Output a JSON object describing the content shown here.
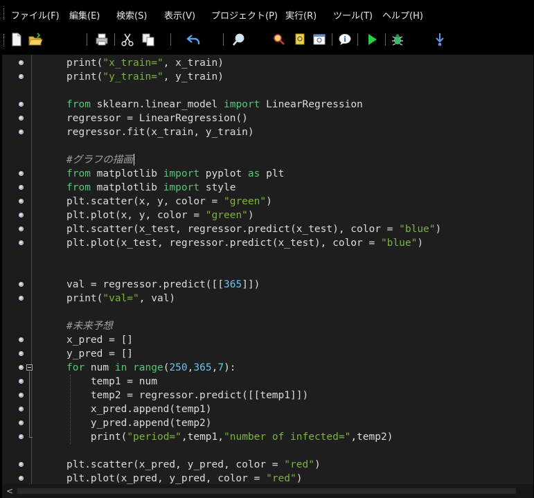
{
  "menu": [
    "ファイル(F)",
    "編集(E)",
    "検索(S)",
    "表示(V)",
    "プロジェクト(P)",
    "実行(R)",
    "ツール(T)",
    "ヘルプ(H)"
  ],
  "toolbar": {
    "icons": [
      "new-file-icon",
      "open-folder-icon",
      "print-icon",
      "cut-icon",
      "copy-icon",
      "undo-icon",
      "find-icon",
      "bookmark-icon",
      "note-icon",
      "window-icon",
      "info-icon",
      "run-icon",
      "debug-icon",
      "step-icon"
    ]
  },
  "editor": {
    "lines": [
      {
        "text": "print(\"x_train=\", x_train)",
        "bp": true
      },
      {
        "text": "print(\"y_train=\", y_train)",
        "bp": true
      },
      {
        "text": "",
        "bp": false
      },
      {
        "text": "from sklearn.linear_model import LinearRegression",
        "bp": true
      },
      {
        "text": "regressor = LinearRegression()",
        "bp": true
      },
      {
        "text": "regressor.fit(x_train, y_train)",
        "bp": true
      },
      {
        "text": "",
        "bp": false
      },
      {
        "text": "#グラフの描画",
        "bp": false
      },
      {
        "text": "from matplotlib import pyplot as plt",
        "bp": true
      },
      {
        "text": "from matplotlib import style",
        "bp": true
      },
      {
        "text": "plt.scatter(x, y, color = \"green\")",
        "bp": true
      },
      {
        "text": "plt.plot(x, y, color = \"green\")",
        "bp": true
      },
      {
        "text": "plt.scatter(x_test, regressor.predict(x_test), color = \"blue\")",
        "bp": true
      },
      {
        "text": "plt.plot(x_test, regressor.predict(x_test), color = \"blue\")",
        "bp": true
      },
      {
        "text": "",
        "bp": false
      },
      {
        "text": "",
        "bp": false
      },
      {
        "text": "val = regressor.predict([[365]])",
        "bp": true
      },
      {
        "text": "print(\"val=\", val)",
        "bp": true
      },
      {
        "text": "",
        "bp": false
      },
      {
        "text": "#未来予想",
        "bp": false
      },
      {
        "text": "x_pred = []",
        "bp": true
      },
      {
        "text": "y_pred = []",
        "bp": true
      },
      {
        "text": "for num in range(250,365,7):",
        "bp": true,
        "fold": true
      },
      {
        "text": "    temp1 = num",
        "bp": true
      },
      {
        "text": "    temp2 = regressor.predict([[temp1]])",
        "bp": true
      },
      {
        "text": "    x_pred.append(temp1)",
        "bp": true
      },
      {
        "text": "    y_pred.append(temp2)",
        "bp": true
      },
      {
        "text": "    print(\"period=\",temp1,\"number of infected=\",temp2)",
        "bp": true,
        "foldend": true
      },
      {
        "text": "",
        "bp": false
      },
      {
        "text": "plt.scatter(x_pred, y_pred, color = \"red\")",
        "bp": true
      },
      {
        "text": "plt.plot(x_pred, y_pred, color = \"red\")",
        "bp": true
      }
    ]
  },
  "hscroll": {
    "left_arrow": "<"
  }
}
